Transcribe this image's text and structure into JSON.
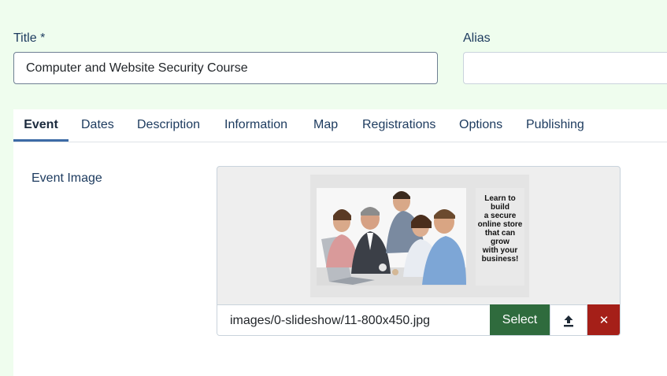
{
  "form": {
    "title_label": "Title *",
    "title_value": "Computer and Website Security Course",
    "alias_label": "Alias",
    "alias_value": ""
  },
  "tabs": [
    {
      "label": "Event",
      "active": true
    },
    {
      "label": "Dates",
      "active": false
    },
    {
      "label": "Description",
      "active": false
    },
    {
      "label": "Information",
      "active": false
    },
    {
      "label": "Map",
      "active": false
    },
    {
      "label": "Registrations",
      "active": false
    },
    {
      "label": "Options",
      "active": false
    },
    {
      "label": "Publishing",
      "active": false
    }
  ],
  "event_image": {
    "label": "Event Image",
    "path": "images/0-slideshow/11-800x450.jpg",
    "select_label": "Select",
    "upload_icon": "upload-icon",
    "clear_icon": "close-icon",
    "clear_glyph": "✕",
    "preview_text": [
      "Learn to",
      "build",
      "a secure",
      "online store",
      "that can",
      "grow",
      "with your",
      "business!"
    ]
  },
  "colors": {
    "page_bg": "#effdee",
    "select_button": "#2f6b3d",
    "clear_button": "#a51f18",
    "active_tab_underline": "#3d6ba6"
  }
}
